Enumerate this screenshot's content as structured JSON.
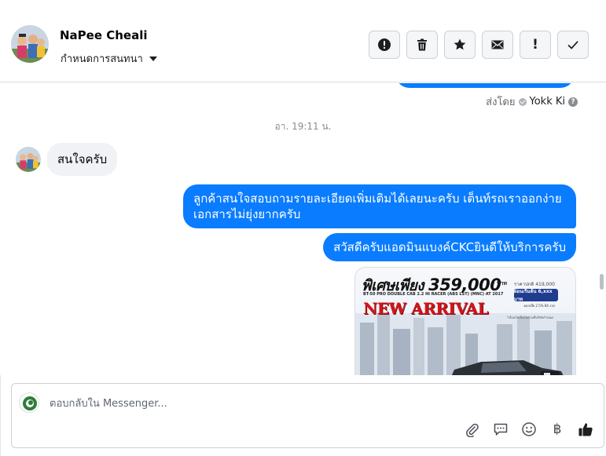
{
  "header": {
    "contact_name": "NaPee Cheali",
    "label_dropdown": "กำหนดการสนทนา",
    "actions": {
      "spam_icon": "!",
      "mark_label": "!"
    }
  },
  "conversation": {
    "sent_by_prefix": "ส่งโดย",
    "sent_by_agent": "Yokk Ki",
    "help_glyph": "?",
    "timestamp": "อา. 19:11 น.",
    "incoming": [
      {
        "text": "สนใจครับ"
      }
    ],
    "outgoing": [
      {
        "text": "ลูกค้าสนใจสอบถามรายละเอียดเพิ่มเติมได้เลยนะครับ เต็นท์รถเราออกง่าย เอกสารไม่ยุ่งยากครับ"
      },
      {
        "text": "สวัสดีครับแอดมินแบงค์CKCยินดีให้บริการครับ"
      }
    ],
    "promo_image": {
      "headline": "พิเศษเพียง",
      "price": "359,000",
      "baht": ".- บาท",
      "normal_price": "ราคาปกติ 419,000",
      "model": "BT-50 PRO DOUBLE CAB 2.2 Hi RACER (ABS LST) (MNC) AT 2017",
      "down_payment": "ผ่อนเริ่มต้น 6,xxx บาท",
      "installment_note": "ดอกเบี้ย 2.5% 84 งวด",
      "title": "NEW ARRIVAL",
      "footnote": "*เงื่อนไขเป็นไปตามที่บริษัทกำหนด"
    }
  },
  "composer": {
    "placeholder": "ตอบกลับใน Messenger...",
    "baht_symbol": "฿"
  }
}
